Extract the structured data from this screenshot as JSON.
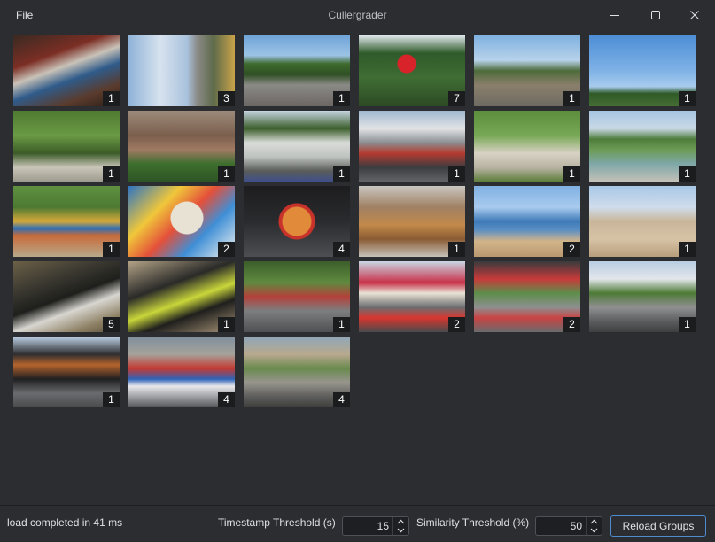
{
  "window": {
    "title": "Cullergrader",
    "menu": {
      "file_label": "File"
    }
  },
  "thumbnails": [
    {
      "count": "1",
      "scene": "desk-with-papers"
    },
    {
      "count": "3",
      "scene": "sky-clouds-street"
    },
    {
      "count": "1",
      "scene": "rooftop-trees"
    },
    {
      "count": "7",
      "scene": "canada-flag-trees"
    },
    {
      "count": "1",
      "scene": "suburban-street"
    },
    {
      "count": "1",
      "scene": "radio-tower-sky"
    },
    {
      "count": "1",
      "scene": "tree-lined-path"
    },
    {
      "count": "1",
      "scene": "brick-house-garden"
    },
    {
      "count": "1",
      "scene": "white-house-trees"
    },
    {
      "count": "1",
      "scene": "street-bus"
    },
    {
      "count": "1",
      "scene": "garden-path"
    },
    {
      "count": "1",
      "scene": "waterfront-beach"
    },
    {
      "count": "1",
      "scene": "playground"
    },
    {
      "count": "2",
      "scene": "drink-can-umbrella"
    },
    {
      "count": "4",
      "scene": "pizza-slice"
    },
    {
      "count": "1",
      "scene": "food-box"
    },
    {
      "count": "2",
      "scene": "beach-people-water"
    },
    {
      "count": "1",
      "scene": "beach-crowd"
    },
    {
      "count": "5",
      "scene": "bags-on-sand"
    },
    {
      "count": "1",
      "scene": "cooler-bag-sand"
    },
    {
      "count": "1",
      "scene": "street-trees-building"
    },
    {
      "count": "2",
      "scene": "storefront-red-car"
    },
    {
      "count": "2",
      "scene": "market-street"
    },
    {
      "count": "1",
      "scene": "busy-street-people"
    },
    {
      "count": "1",
      "scene": "shop-front-people"
    },
    {
      "count": "4",
      "scene": "streetcar-pepsi-truck"
    },
    {
      "count": "4",
      "scene": "intersection-crowd"
    }
  ],
  "statusbar": {
    "status_text": "load completed in 41 ms",
    "timestamp_label": "Timestamp Threshold (s)",
    "timestamp_value": "15",
    "similarity_label": "Similarity Threshold (%)",
    "similarity_value": "50",
    "reload_label": "Reload Groups"
  },
  "icons": {
    "minimize": "minimize-icon",
    "maximize": "maximize-icon",
    "close": "close-icon",
    "spin_up": "chevron-up-icon",
    "spin_down": "chevron-down-icon"
  },
  "colors": {
    "background": "#2b2d30",
    "text": "#dfe1e5",
    "accent_border": "#4f8ccf",
    "badge_bg": "#1b1c1e"
  }
}
